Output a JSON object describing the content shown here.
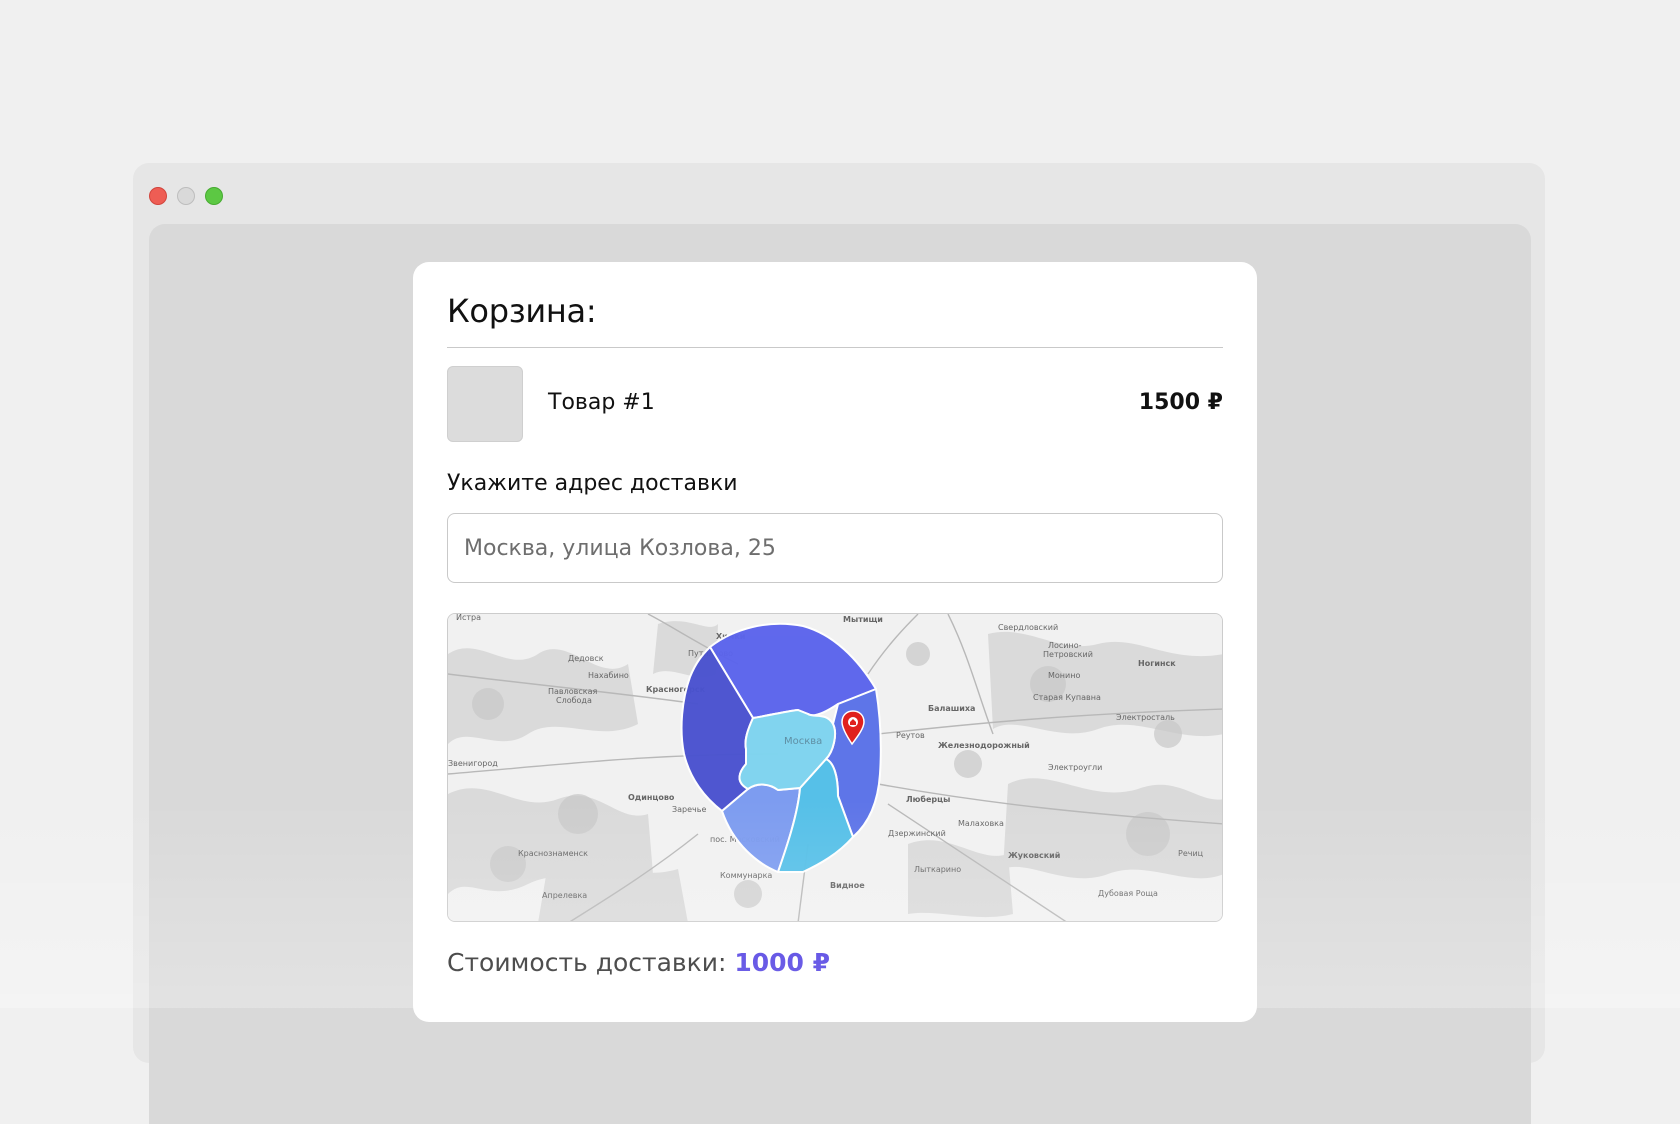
{
  "cart": {
    "title": "Корзина:"
  },
  "product": {
    "name": "Товар #1",
    "price": "1500 ₽"
  },
  "delivery": {
    "address_label": "Укажите адрес доставки",
    "address_placeholder": "Москва, улица Козлова, 25",
    "cost_label": "Стоимость доставки:",
    "cost_value": "1000 ₽"
  },
  "map": {
    "city_label": "Москва",
    "place_labels": [
      "Истра",
      "Химки",
      "Мытищи",
      "Свердловский",
      "Лосино-Петровский",
      "Дедовск",
      "Путилково",
      "Нахабино",
      "Павловская Слобода",
      "Красногорск",
      "Балашиха",
      "Ногинск",
      "Старая Купавна",
      "Монино",
      "Реутов",
      "Железнодорожный",
      "Электросталь",
      "Электроугли",
      "Звенигород",
      "Одинцово",
      "Люберцы",
      "Малаховка",
      "Заречье",
      "пос. Московский",
      "Дзержинский",
      "Жуковский",
      "Краснознаменск",
      "Коммунарка",
      "Видное",
      "Апрелевка",
      "Лыткарино",
      "Дубовая Роща",
      "Речиц"
    ],
    "zone_colors": {
      "north": "#5b64ec",
      "west": "#4a52cf",
      "east": "#5a72e8",
      "southwest": "#7a9af0",
      "south": "#52bfe8",
      "center": "#7fd4ef"
    },
    "pin_color": "#e0201e"
  },
  "window": {
    "accent_close": "#ee5d54",
    "accent_minimize": "#d9d9d9",
    "accent_zoom": "#5cc843"
  }
}
